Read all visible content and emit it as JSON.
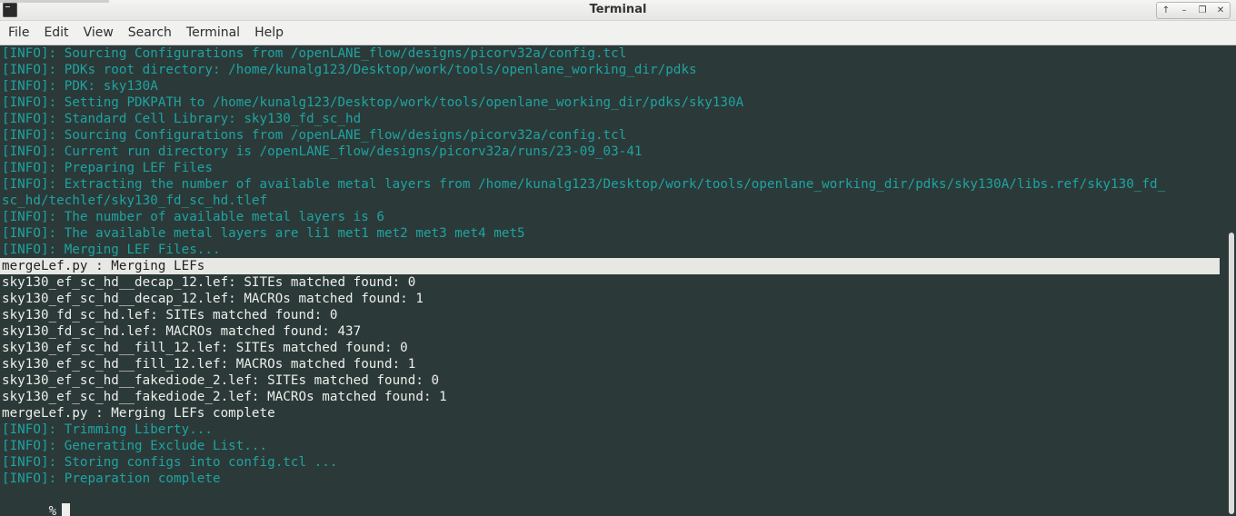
{
  "window": {
    "title": "Terminal"
  },
  "menu": [
    "File",
    "Edit",
    "View",
    "Search",
    "Terminal",
    "Help"
  ],
  "lines": [
    {
      "type": "info",
      "text": "[INFO]: Sourcing Configurations from /openLANE_flow/designs/picorv32a/config.tcl"
    },
    {
      "type": "info",
      "text": "[INFO]: PDKs root directory: /home/kunalg123/Desktop/work/tools/openlane_working_dir/pdks"
    },
    {
      "type": "info",
      "text": "[INFO]: PDK: sky130A"
    },
    {
      "type": "info",
      "text": "[INFO]: Setting PDKPATH to /home/kunalg123/Desktop/work/tools/openlane_working_dir/pdks/sky130A"
    },
    {
      "type": "info",
      "text": "[INFO]: Standard Cell Library: sky130_fd_sc_hd"
    },
    {
      "type": "info",
      "text": "[INFO]: Sourcing Configurations from /openLANE_flow/designs/picorv32a/config.tcl"
    },
    {
      "type": "info",
      "text": "[INFO]: Current run directory is /openLANE_flow/designs/picorv32a/runs/23-09_03-41"
    },
    {
      "type": "info",
      "text": "[INFO]: Preparing LEF Files"
    },
    {
      "type": "info",
      "text": "[INFO]: Extracting the number of available metal layers from /home/kunalg123/Desktop/work/tools/openlane_working_dir/pdks/sky130A/libs.ref/sky130_fd_"
    },
    {
      "type": "info",
      "text": "sc_hd/techlef/sky130_fd_sc_hd.tlef"
    },
    {
      "type": "info",
      "text": "[INFO]: The number of available metal layers is 6"
    },
    {
      "type": "info",
      "text": "[INFO]: The available metal layers are li1 met1 met2 met3 met4 met5"
    },
    {
      "type": "info",
      "text": "[INFO]: Merging LEF Files..."
    },
    {
      "type": "highlight",
      "text": "mergeLef.py : Merging LEFs"
    },
    {
      "type": "out",
      "text": "sky130_ef_sc_hd__decap_12.lef: SITEs matched found: 0"
    },
    {
      "type": "out",
      "text": "sky130_ef_sc_hd__decap_12.lef: MACROs matched found: 1"
    },
    {
      "type": "out",
      "text": "sky130_fd_sc_hd.lef: SITEs matched found: 0"
    },
    {
      "type": "out",
      "text": "sky130_fd_sc_hd.lef: MACROs matched found: 437"
    },
    {
      "type": "out",
      "text": "sky130_ef_sc_hd__fill_12.lef: SITEs matched found: 0"
    },
    {
      "type": "out",
      "text": "sky130_ef_sc_hd__fill_12.lef: MACROs matched found: 1"
    },
    {
      "type": "out",
      "text": "sky130_ef_sc_hd__fakediode_2.lef: SITEs matched found: 0"
    },
    {
      "type": "out",
      "text": "sky130_ef_sc_hd__fakediode_2.lef: MACROs matched found: 1"
    },
    {
      "type": "out",
      "text": "mergeLef.py : Merging LEFs complete"
    },
    {
      "type": "info",
      "text": "[INFO]: Trimming Liberty..."
    },
    {
      "type": "info",
      "text": "[INFO]: Generating Exclude List..."
    },
    {
      "type": "info",
      "text": "[INFO]: Storing configs into config.tcl ..."
    },
    {
      "type": "info",
      "text": "[INFO]: Preparation complete"
    }
  ],
  "prompt": "%",
  "colors": {
    "background": "#2b3a38",
    "info": "#1fa3a3",
    "output": "#eeeeec",
    "highlight": "#e7e8e3"
  },
  "icons": {
    "window_controls": [
      "up-arrow-icon",
      "minimize-icon",
      "maximize-icon",
      "close-icon"
    ]
  }
}
